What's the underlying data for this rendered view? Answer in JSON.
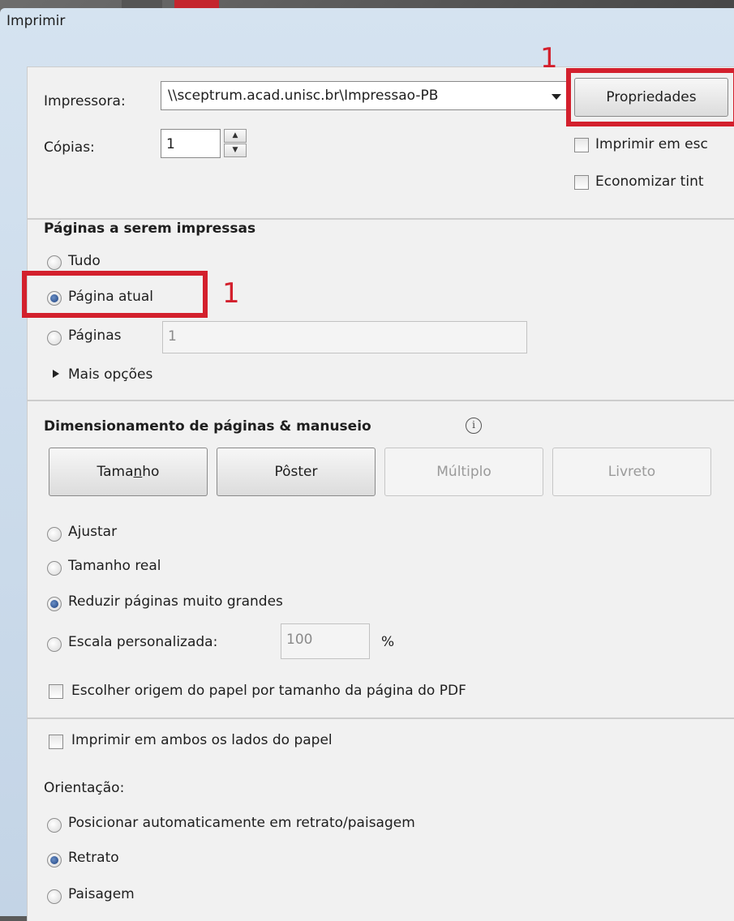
{
  "dialog": {
    "title": "Imprimir"
  },
  "printer": {
    "label": "Impressora:",
    "selected": "\\\\sceptrum.acad.unisc.br\\Impressao-PB",
    "properties_button": "Propriedades",
    "copies_label": "Cópias:",
    "copies_value": "1",
    "grayscale_label": "Imprimir em esc",
    "save_ink_label": "Economizar tint"
  },
  "annotations": {
    "marker_1": "1",
    "marker_2": "1",
    "highlight_color": "#d3202d"
  },
  "pages": {
    "heading": "Páginas a serem impressas",
    "all": "Tudo",
    "current": "Página atual",
    "range": "Páginas",
    "range_value": "1",
    "more_options": "Mais opções"
  },
  "sizing": {
    "heading": "Dimensionamento de páginas & manuseio",
    "info_icon": "i",
    "buttons": {
      "size": {
        "pre": "Tama",
        "mnemonic": "n",
        "post": "ho"
      },
      "poster": "Pôster",
      "multiple": "Múltiplo",
      "booklet": "Livreto"
    },
    "fit": "Ajustar",
    "actual_size": "Tamanho real",
    "shrink": "Reduzir páginas muito grandes",
    "custom_scale": "Escala personalizada:",
    "custom_scale_value": "100",
    "percent": "%",
    "paper_source": "Escolher origem do papel por tamanho da página do PDF"
  },
  "duplex": {
    "both_sides": "Imprimir em ambos os lados do papel"
  },
  "orientation": {
    "label": "Orientação:",
    "auto": "Posicionar automaticamente em retrato/paisagem",
    "portrait": "Retrato",
    "landscape": "Paisagem"
  }
}
